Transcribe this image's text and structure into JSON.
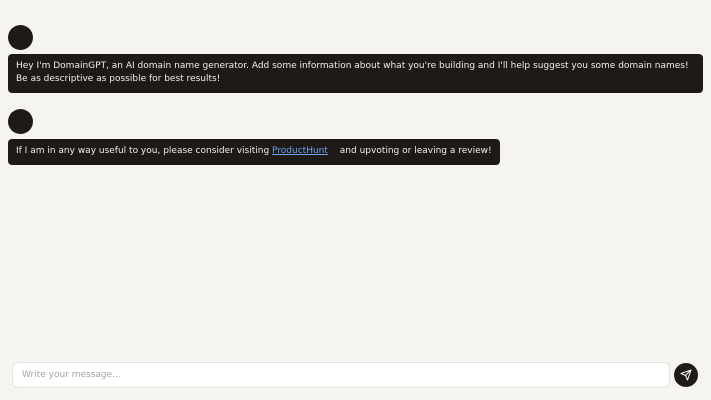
{
  "messages": [
    {
      "text": "Hey I'm DomainGPT, an AI domain name generator. Add some information about what you're building and I'll help suggest you some domain names! Be as descriptive as possible for best results!"
    },
    {
      "text_before": "If I am in any way useful to you, please consider visiting ",
      "link_text": "ProductHunt",
      "text_after": " and upvoting or leaving a review!"
    }
  ],
  "composer": {
    "placeholder": "Write your message..."
  },
  "icons": {
    "send": "send-icon"
  },
  "colors": {
    "background": "#f5f4f1",
    "bubble": "#1e1a17",
    "bubble_text": "#f1ede8",
    "link": "#6ea2ef"
  }
}
